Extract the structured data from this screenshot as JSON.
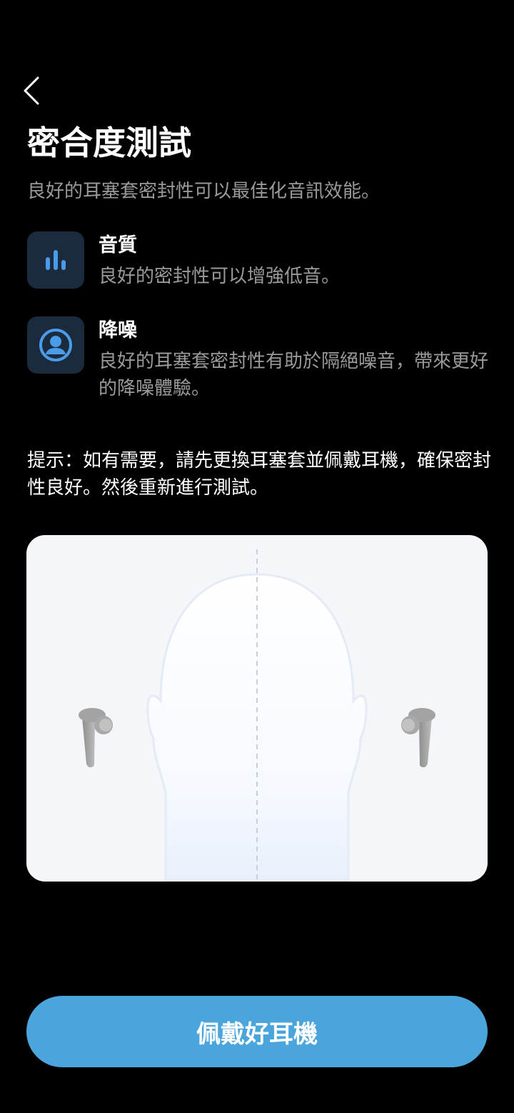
{
  "header": {
    "back_label": "Back",
    "title": "密合度測試",
    "subtitle": "良好的耳塞套密封性可以最佳化音訊效能。"
  },
  "features": [
    {
      "icon": "sound-bars-icon",
      "title": "音質",
      "description": "良好的密封性可以增強低音。"
    },
    {
      "icon": "user-noise-icon",
      "title": "降噪",
      "description": "良好的耳塞套密封性有助於隔絕噪音，帶來更好的降噪體驗。"
    }
  ],
  "tip": "提示：如有需要，請先更換耳塞套並佩戴耳機，確保密封性良好。然後重新進行測試。",
  "illustration": {
    "icon": "head-with-earbuds-illustration"
  },
  "action": {
    "primary_label": "佩戴好耳機"
  },
  "colors": {
    "background": "#000000",
    "accent": "#4aa5dc",
    "icon_tile": "#1b2a3c",
    "icon_blue": "#4a9be8",
    "secondary_text": "#9a9a9a",
    "card_bg": "#f4f6f9"
  }
}
